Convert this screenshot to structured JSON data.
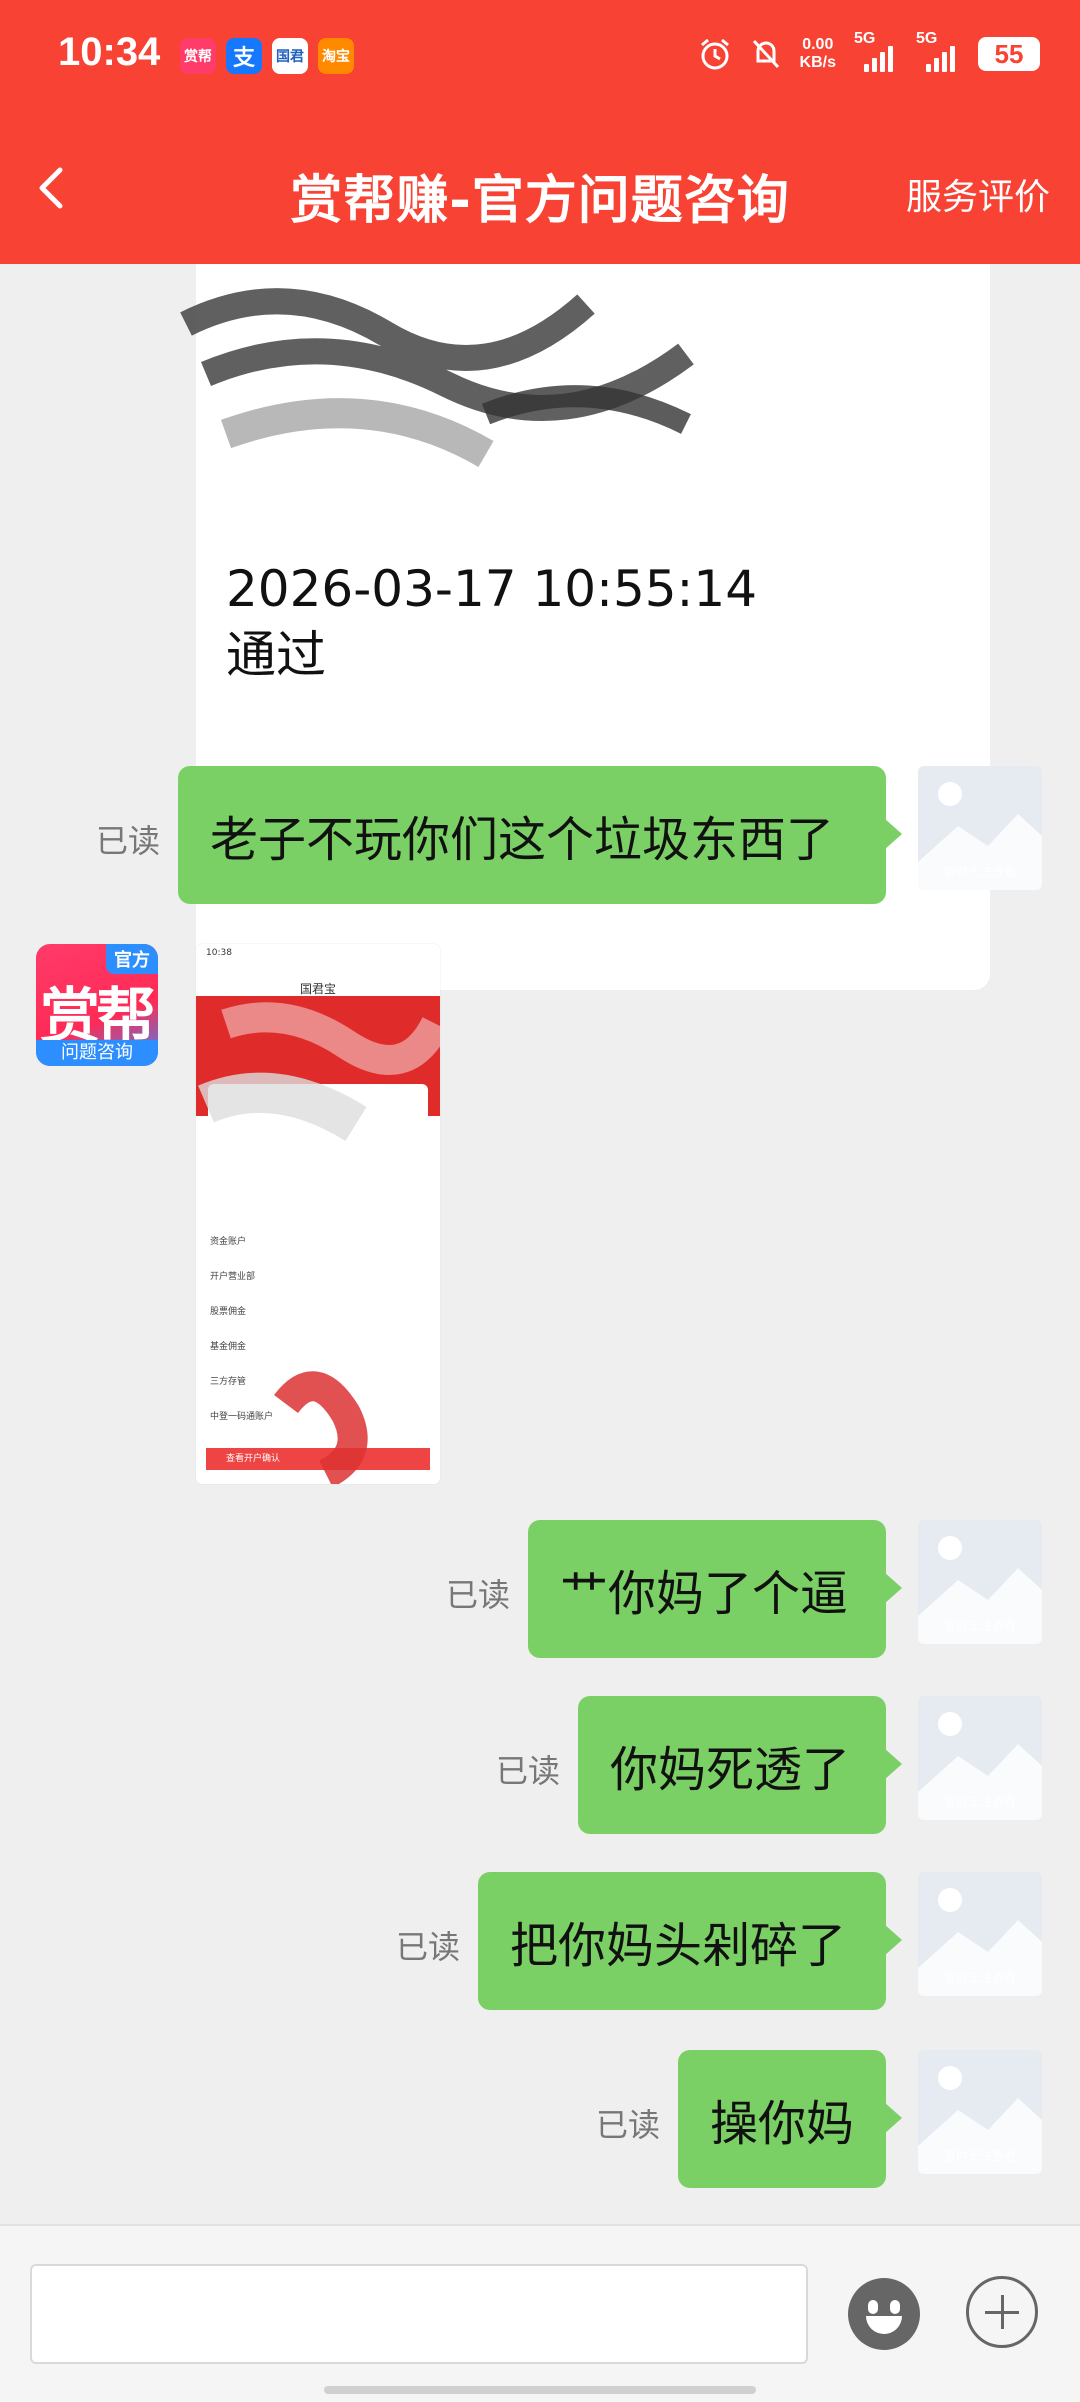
{
  "status_bar": {
    "time": "10:34",
    "apps": [
      "赏帮",
      "支",
      "国君",
      "淘宝"
    ],
    "net_speed_value": "0.00",
    "net_speed_unit": "KB/s",
    "signal_1": "5G",
    "signal_2": "5G",
    "battery": "55"
  },
  "header": {
    "title": "赏帮赚-官方问题咨询",
    "action": "服务评价"
  },
  "card": {
    "lines": [
      "2026-03-17 10:55:14",
      "通过"
    ]
  },
  "official": {
    "tag": "官方",
    "name": "赏帮",
    "sub": "问题咨询"
  },
  "shot": {
    "time": "10:38",
    "title": "国君宝",
    "rows": [
      {
        "label": "资金账户",
        "value": ""
      },
      {
        "label": "开户营业部",
        "value": ""
      },
      {
        "label": "股票佣金",
        "value": ""
      },
      {
        "label": "基金佣金",
        "value": ""
      },
      {
        "label": "三方存管",
        "value": ""
      },
      {
        "label": "中登一码通账户",
        "value": ""
      }
    ],
    "button": "查看开户确认"
  },
  "messages": [
    {
      "text": "老子不玩你们这个垃圾东西了",
      "status": "已读"
    },
    {
      "text": "艹你妈了个逼",
      "status": "已读"
    },
    {
      "text": "你妈死透了",
      "status": "已读"
    },
    {
      "text": "把你妈头剁碎了",
      "status": "已读"
    },
    {
      "text": "操你妈",
      "status": "已读"
    }
  ],
  "avatar_placeholder": "暂时无法查看"
}
